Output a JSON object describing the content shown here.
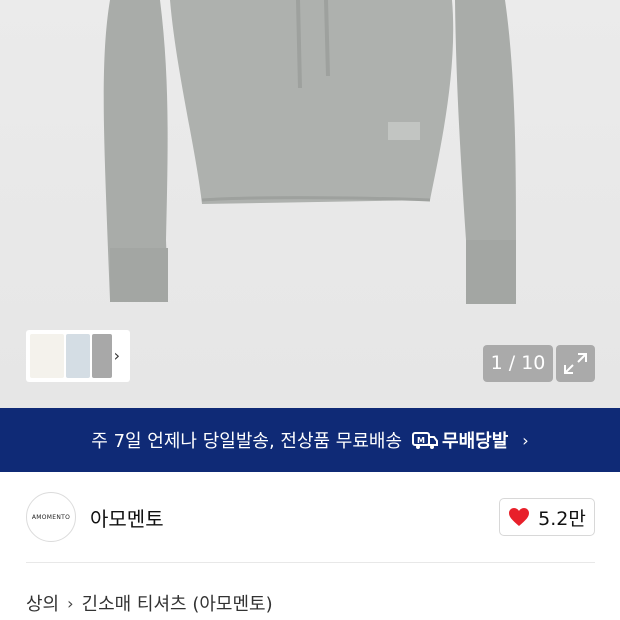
{
  "gallery": {
    "counter": "1 / 10",
    "thumbnail_icons": [
      "beige-hoodie",
      "light-blue-hoodie",
      "gray-hoodie"
    ]
  },
  "banner": {
    "text": "주 7일 언제나 당일발송, 전상품 무료배송",
    "brand_label": "무배당발",
    "background_color": "#0f2a76"
  },
  "brand": {
    "logo_text": "AMOMENTO",
    "name": "아모멘토",
    "likes": "5.2만",
    "heart_color": "#e8202a"
  },
  "breadcrumb": {
    "category": "상의",
    "subcategory": "긴소매 티셔츠 (아모멘토)"
  }
}
